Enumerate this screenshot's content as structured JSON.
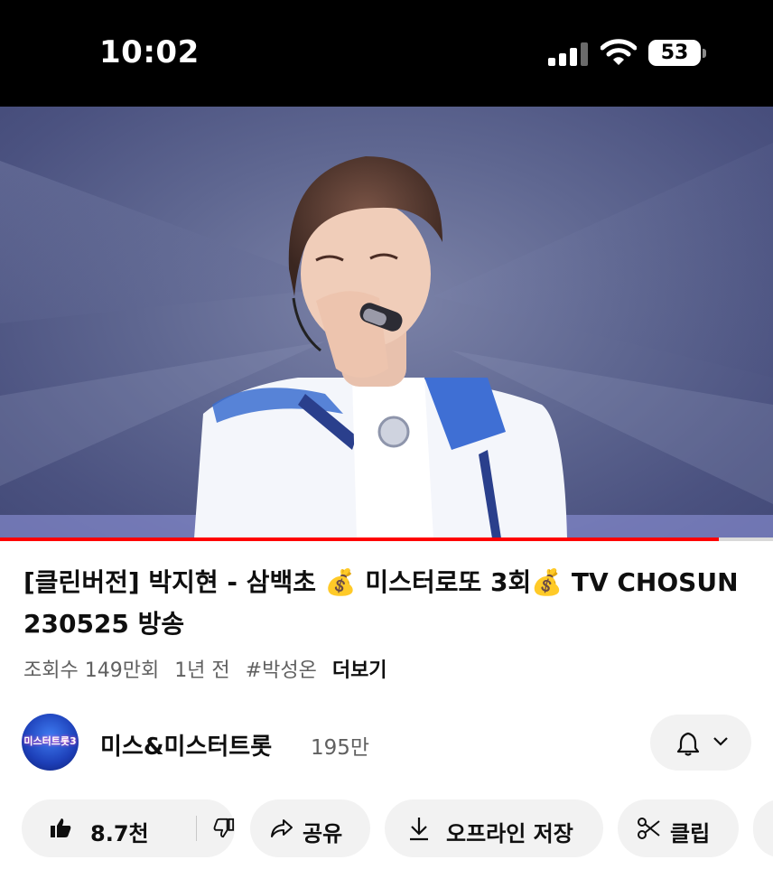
{
  "status_bar": {
    "time": "10:02",
    "battery_level": "53",
    "icons": [
      "cellular-signal-icon",
      "wifi-icon",
      "battery-icon"
    ]
  },
  "video": {
    "progress_fraction": 0.93
  },
  "title": {
    "part1": "[클린버전] 박지현 - 삼백초 ",
    "emoji1": "💰",
    "part2": " 미스터로또 3회",
    "emoji2": "💰",
    "part3": " TV CHOSUN 230525 방송"
  },
  "meta": {
    "views": "조회수 149만회",
    "age": "1년 전",
    "hashtag": "#박성온",
    "more": "더보기"
  },
  "channel": {
    "avatar_text": "미스터트롯3",
    "name": "미스&미스터트롯",
    "subscribers": "195만"
  },
  "actions": {
    "like_count": "8.7천",
    "share": "공유",
    "download": "오프라인 저장",
    "clip": "클립"
  },
  "colors": {
    "accent": "#ff0000",
    "chip_bg": "#f2f2f2",
    "secondary_text": "#606060"
  }
}
